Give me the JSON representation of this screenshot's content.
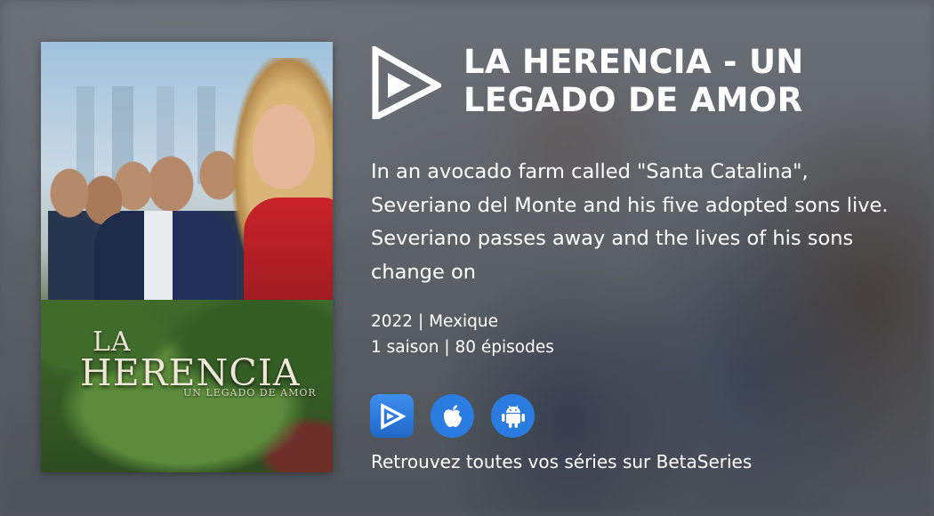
{
  "show": {
    "title": "LA HERENCIA - UN LEGADO DE AMOR",
    "description": "In an avocado farm called \"Santa Catalina\", Severiano del Monte and his five adopted sons live. Severiano passes away and the lives of his sons change on",
    "meta_line1": "2022 | Mexique",
    "meta_line2": "1 saison | 80 épisodes"
  },
  "poster": {
    "title_la": "LA",
    "title_main": "HERENCIA",
    "title_sub": "UN LEGADO DE AMOR"
  },
  "apps": [
    {
      "icon": "betaseries-app-icon"
    },
    {
      "icon": "apple-icon"
    },
    {
      "icon": "android-icon"
    }
  ],
  "tagline": "Retrouvez toutes vos séries sur BetaSeries",
  "colors": {
    "accent": "#2b7ce0",
    "text": "#ffffff"
  }
}
